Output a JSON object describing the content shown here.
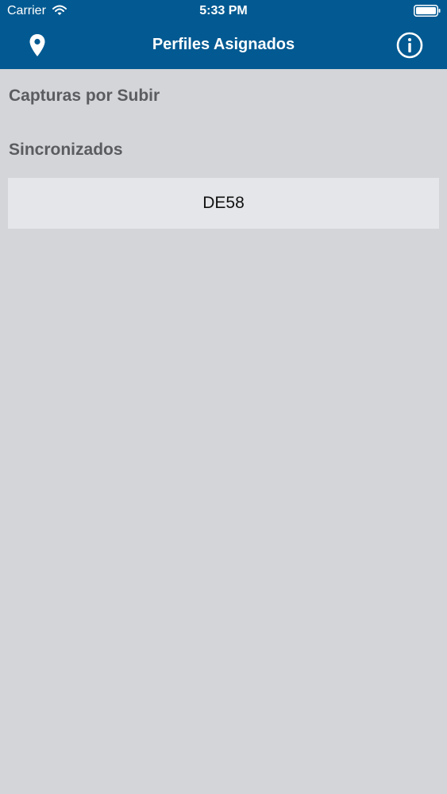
{
  "status_bar": {
    "carrier": "Carrier",
    "time": "5:33 PM",
    "wifi_icon": "wifi-icon",
    "battery_icon": "battery-icon"
  },
  "nav": {
    "title": "Perfiles Asignados",
    "left_icon": "location-pin-icon",
    "right_icon": "info-icon"
  },
  "sections": [
    {
      "title": "Capturas por Subir",
      "items": []
    },
    {
      "title": "Sincronizados",
      "items": [
        {
          "label": "DE58"
        }
      ]
    }
  ],
  "colors": {
    "header_bg": "#035a92",
    "page_bg": "#d3d5d8",
    "row_bg": "#e5e6e9",
    "section_text": "#5a5c5f"
  }
}
